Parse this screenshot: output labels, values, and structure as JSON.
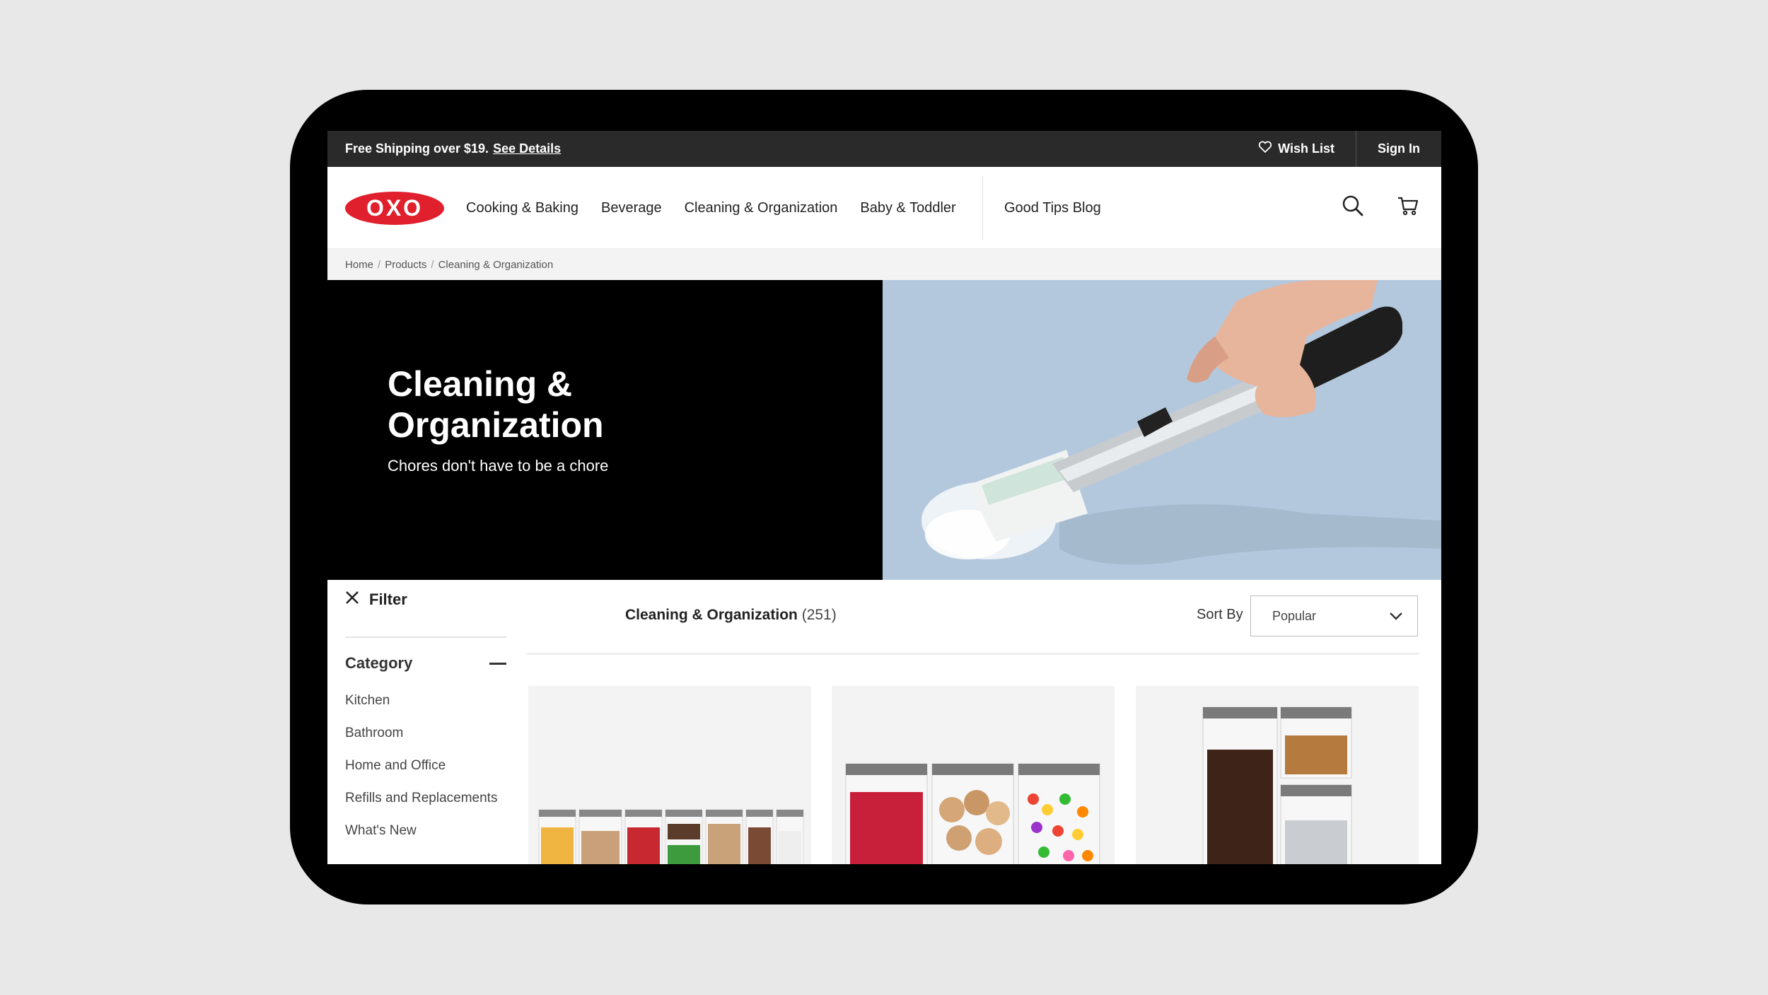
{
  "promo": {
    "text": "Free Shipping over $19.",
    "link": "See Details",
    "wishlist": "Wish List",
    "signin": "Sign In"
  },
  "nav": {
    "logo": "OXO",
    "links": [
      "Cooking & Baking",
      "Beverage",
      "Cleaning & Organization",
      "Baby & Toddler"
    ],
    "blog": "Good Tips Blog"
  },
  "breadcrumb": [
    "Home",
    "Products",
    "Cleaning & Organization"
  ],
  "hero": {
    "title": "Cleaning & Organization",
    "subtitle": "Chores don't have to be a chore"
  },
  "filter": {
    "label": "Filter",
    "category_label": "Category",
    "categories": [
      "Kitchen",
      "Bathroom",
      "Home and Office",
      "Refills and Replacements",
      "What's New"
    ]
  },
  "listing": {
    "title": "Cleaning & Organization",
    "count": "(251)",
    "sort_label": "Sort By",
    "sort_value": "Popular"
  },
  "colors": {
    "brand_red": "#e0202c",
    "promo_bg": "#2a2a2a",
    "hero_blue": "#b4c8dd"
  }
}
